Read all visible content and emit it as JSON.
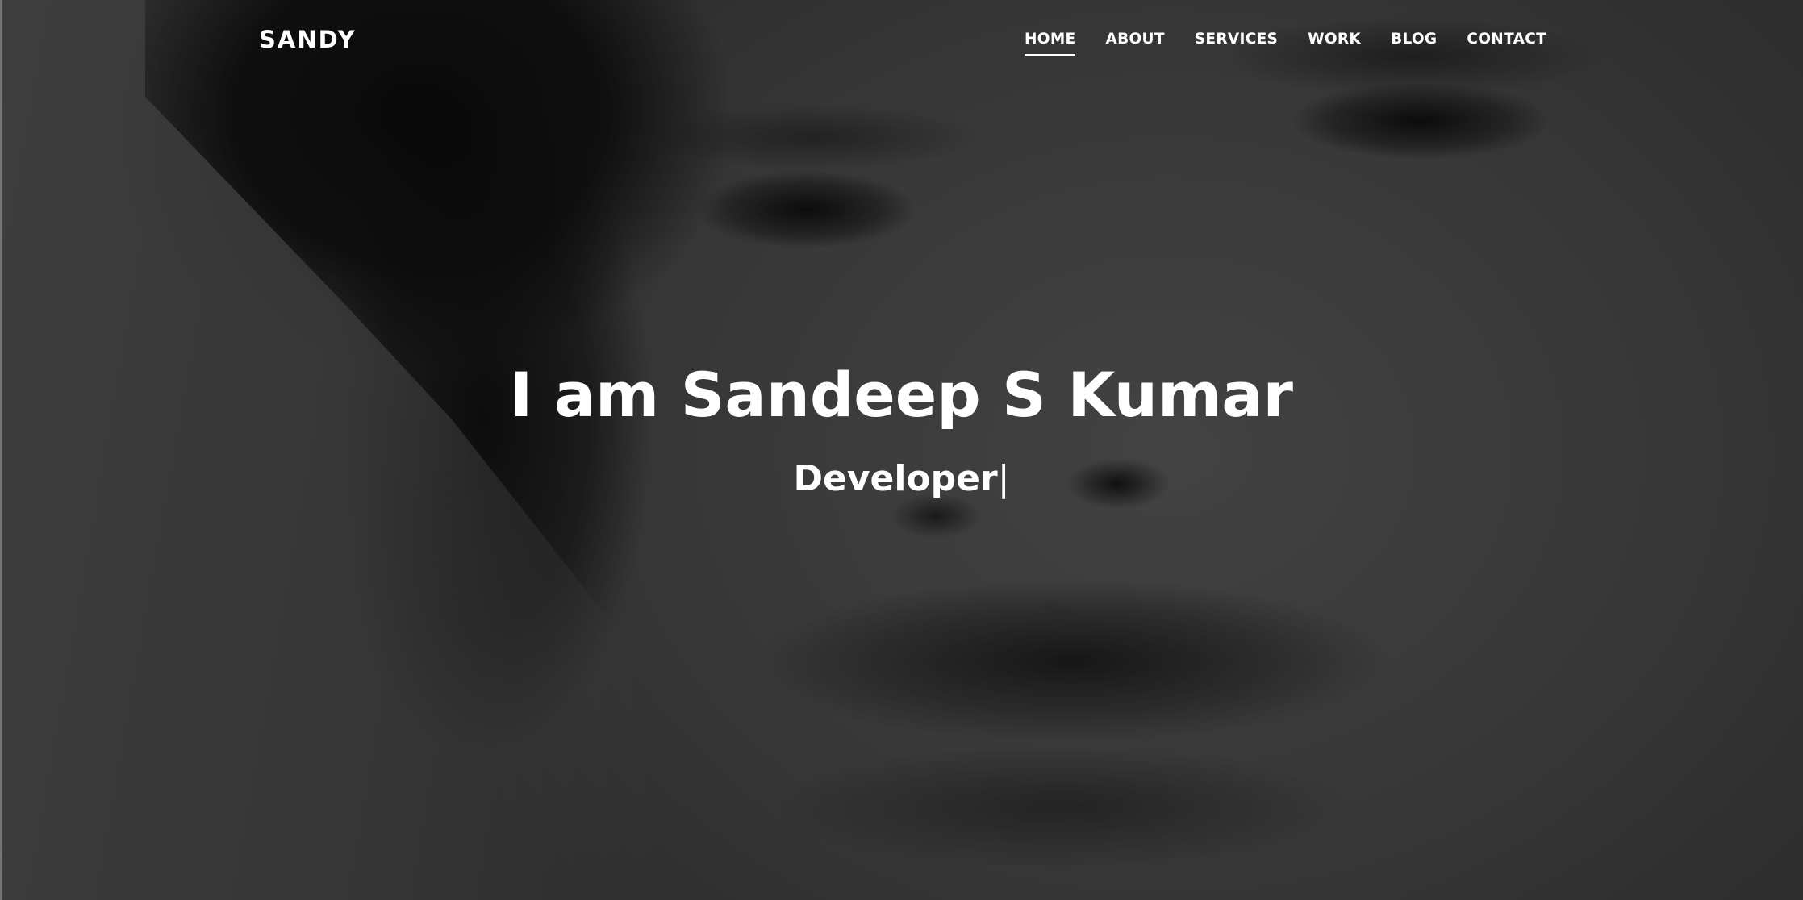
{
  "brand": {
    "name": "SANDY"
  },
  "nav": {
    "items": [
      {
        "label": "HOME",
        "active": true
      },
      {
        "label": "ABOUT",
        "active": false
      },
      {
        "label": "SERVICES",
        "active": false
      },
      {
        "label": "WORK",
        "active": false
      },
      {
        "label": "BLOG",
        "active": false
      },
      {
        "label": "CONTACT",
        "active": false
      }
    ]
  },
  "hero": {
    "title": "I am Sandeep S Kumar",
    "subtitle": "Developer",
    "cursor": "|"
  },
  "colors": {
    "text": "#ffffff",
    "overlay": "#000000"
  }
}
